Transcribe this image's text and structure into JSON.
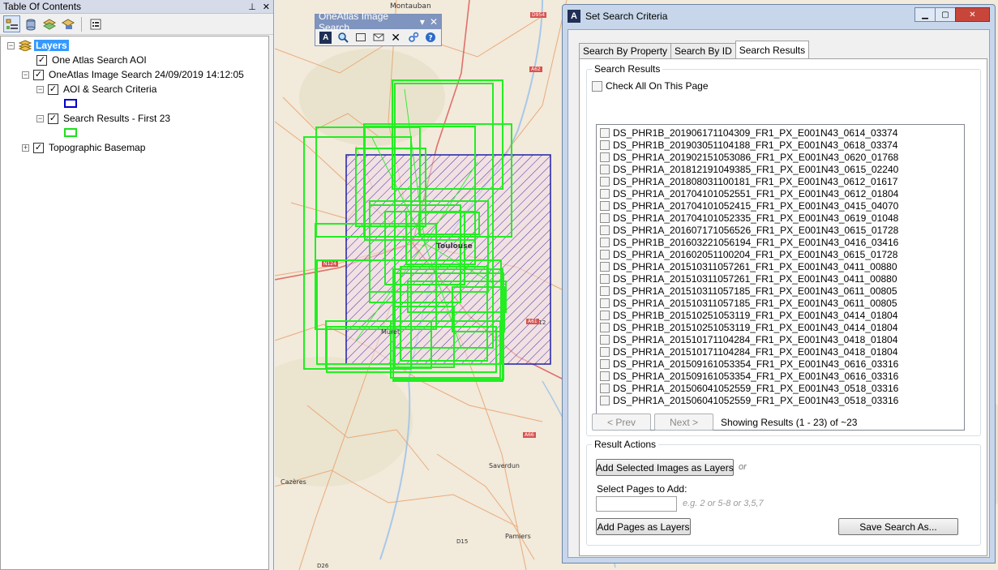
{
  "toc": {
    "title": "Table Of Contents",
    "pin_glyph": "⊥",
    "close_glyph": "✕",
    "toolbar_icons": [
      "list-by-drawing-order-icon",
      "list-by-source-icon",
      "list-by-visibility-icon",
      "list-by-selection-icon",
      "options-icon"
    ],
    "root_label": "Layers",
    "layers": [
      {
        "label": "One Atlas Search AOI",
        "checked": true
      },
      {
        "label": "OneAtlas Image Search 24/09/2019 14:12:05",
        "checked": true,
        "expanded": true
      },
      {
        "label": "AOI & Search Criteria",
        "checked": true,
        "expanded": true,
        "swatch_color": "#0000cc"
      },
      {
        "label": "Search Results - First 23",
        "checked": true,
        "expanded": true,
        "swatch_color": "#22dd22"
      },
      {
        "label": "Topographic Basemap",
        "checked": true,
        "expanded": false
      }
    ]
  },
  "map": {
    "labels": {
      "montauban": "Montauban",
      "toulouse": "Toulouse",
      "muret": "Muret",
      "saverdun": "Saverdun",
      "cazeres": "Cazères",
      "pamiers": "Pamiers",
      "d26": "D26",
      "d15": "D15",
      "d12": "D12"
    },
    "road_badges": {
      "a20": "D954",
      "a62": "A62",
      "a64": "A64",
      "n124": "N124",
      "a66": "A66",
      "a61": "A61"
    },
    "aoi_color": "#1f1fa8",
    "result_color": "#22ee22"
  },
  "oneatlas_toolbar": {
    "title": "OneAtlas Image Search",
    "dropdown_glyph": "▾",
    "close_glyph": "✕",
    "tools": [
      "oneatlas-logo-icon",
      "zoom-icon",
      "rectangle-icon",
      "envelope-icon",
      "clear-icon",
      "settings-icon",
      "help-icon"
    ]
  },
  "dialog": {
    "title": "Set Search Criteria",
    "tabs": [
      "Search By Property",
      "Search By ID",
      "Search Results"
    ],
    "active_tab": 2,
    "search_results_group": "Search Results",
    "check_all_label": "Check All On This Page",
    "results": [
      "DS_PHR1B_201906171104309_FR1_PX_E001N43_0614_03374",
      "DS_PHR1B_201903051104188_FR1_PX_E001N43_0618_03374",
      "DS_PHR1A_201902151053086_FR1_PX_E001N43_0620_01768",
      "DS_PHR1A_201812191049385_FR1_PX_E001N43_0615_02240",
      "DS_PHR1A_201808031100181_FR1_PX_E001N43_0612_01617",
      "DS_PHR1A_201704101052551_FR1_PX_E001N43_0612_01804",
      "DS_PHR1A_201704101052415_FR1_PX_E001N43_0415_04070",
      "DS_PHR1A_201704101052335_FR1_PX_E001N43_0619_01048",
      "DS_PHR1A_201607171056526_FR1_PX_E001N43_0615_01728",
      "DS_PHR1B_201603221056194_FR1_PX_E001N43_0416_03416",
      "DS_PHR1A_201602051100204_FR1_PX_E001N43_0615_01728",
      "DS_PHR1A_201510311057261_FR1_PX_E001N43_0411_00880",
      "DS_PHR1A_201510311057261_FR1_PX_E001N43_0411_00880",
      "DS_PHR1A_201510311057185_FR1_PX_E001N43_0611_00805",
      "DS_PHR1A_201510311057185_FR1_PX_E001N43_0611_00805",
      "DS_PHR1B_201510251053119_FR1_PX_E001N43_0414_01804",
      "DS_PHR1B_201510251053119_FR1_PX_E001N43_0414_01804",
      "DS_PHR1A_201510171104284_FR1_PX_E001N43_0418_01804",
      "DS_PHR1A_201510171104284_FR1_PX_E001N43_0418_01804",
      "DS_PHR1A_201509161053354_FR1_PX_E001N43_0616_03316",
      "DS_PHR1A_201509161053354_FR1_PX_E001N43_0616_03316",
      "DS_PHR1A_201506041052559_FR1_PX_E001N43_0518_03316",
      "DS_PHR1A_201506041052559_FR1_PX_E001N43_0518_03316"
    ],
    "prev_label": "< Prev",
    "next_label": "Next >",
    "showing_text": "Showing Results (1 - 23) of ~23",
    "result_actions_group": "Result Actions",
    "add_selected_label": "Add Selected Images as Layers",
    "or_text": "or",
    "select_pages_label": "Select Pages to Add:",
    "pages_value": "",
    "pages_hint": "e.g. 2 or 5-8 or 3,5,7",
    "add_pages_label": "Add Pages as Layers",
    "save_search_label": "Save Search As..."
  }
}
